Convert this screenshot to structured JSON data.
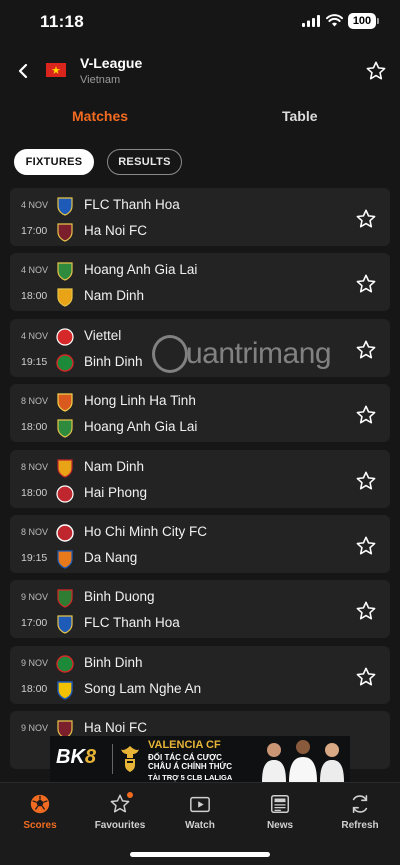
{
  "status_bar": {
    "time": "11:18",
    "battery": "100"
  },
  "header": {
    "title": "V-League",
    "country": "Vietnam",
    "flag_color": "#da251d",
    "star_color": "#ffd500"
  },
  "tabs": [
    {
      "label": "Matches",
      "active": true
    },
    {
      "label": "Table",
      "active": false
    }
  ],
  "filters": [
    {
      "label": "FIXTURES",
      "active": true
    },
    {
      "label": "RESULTS",
      "active": false
    }
  ],
  "matches": [
    {
      "date": "4 NOV",
      "time": "17:00",
      "home": "FLC Thanh Hoa",
      "away": "Ha Noi FC",
      "home_color": "#1e5bb8",
      "away_color": "#7a1f2b"
    },
    {
      "date": "4 NOV",
      "time": "18:00",
      "home": "Hoang Anh Gia Lai",
      "away": "Nam Dinh",
      "home_color": "#2e8b3e",
      "away_color": "#e8a317"
    },
    {
      "date": "4 NOV",
      "time": "19:15",
      "home": "Viettel",
      "away": "Binh Dinh",
      "home_color": "#d62828",
      "away_color": "#1d8a3a"
    },
    {
      "date": "8 NOV",
      "time": "18:00",
      "home": "Hong Linh Ha Tinh",
      "away": "Hoang Anh Gia Lai",
      "home_color": "#d9591f",
      "away_color": "#2e8b3e"
    },
    {
      "date": "8 NOV",
      "time": "18:00",
      "home": "Nam Dinh",
      "away": "Hai Phong",
      "home_color": "#e8a317",
      "away_color": "#c0262d"
    },
    {
      "date": "8 NOV",
      "time": "19:15",
      "home": "Ho Chi Minh City FC",
      "away": "Da Nang",
      "home_color": "#c0262d",
      "away_color": "#e87a1b"
    },
    {
      "date": "9 NOV",
      "time": "17:00",
      "home": "Binh Duong",
      "away": "FLC Thanh Hoa",
      "home_color": "#2e7d32",
      "away_color": "#1e5bb8"
    },
    {
      "date": "9 NOV",
      "time": "18:00",
      "home": "Binh Dinh",
      "away": "Song Lam Nghe An",
      "home_color": "#1d8a3a",
      "away_color": "#f2c200"
    },
    {
      "date": "9 NOV",
      "time": "",
      "home": "Ha Noi FC",
      "away": "",
      "home_color": "#7a1f2b",
      "away_color": ""
    }
  ],
  "watermark": {
    "text": "uantrimang"
  },
  "ad": {
    "logo_a": "BK",
    "logo_b": "8",
    "line1": "VALENCIA CF",
    "line2": "ĐỐI TÁC CÁ CƯỢC",
    "line3": "CHÂU Á CHÍNH THỨC",
    "line4": "TÀI TRỢ 5 CLB LALIGA"
  },
  "nav": [
    {
      "label": "Scores",
      "icon": "soccer-ball-icon",
      "active": true
    },
    {
      "label": "Favourites",
      "icon": "star-outline-icon",
      "active": false
    },
    {
      "label": "Watch",
      "icon": "video-icon",
      "active": false
    },
    {
      "label": "News",
      "icon": "newspaper-icon",
      "active": false
    },
    {
      "label": "Refresh",
      "icon": "refresh-icon",
      "active": false
    }
  ],
  "colors": {
    "accent": "#f26b21",
    "background": "#161616",
    "card": "#232323"
  }
}
